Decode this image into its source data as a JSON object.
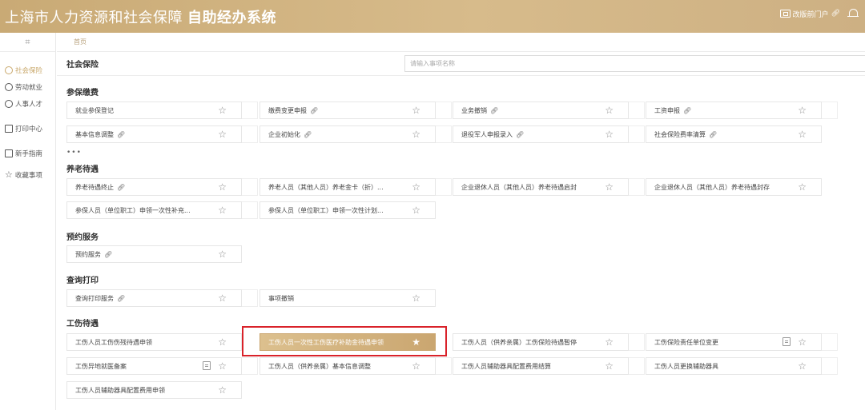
{
  "header": {
    "title_prefix": "上海市人力资源和社会保障",
    "title_bold": "自助经办系统",
    "portal_label": "改版前门户"
  },
  "sidebar": {
    "top_icon": "grid-icon",
    "items": [
      {
        "label": "社会保险",
        "icon": "social-insurance-icon",
        "active": true
      },
      {
        "label": "劳动就业",
        "icon": "employment-icon"
      },
      {
        "label": "人事人才",
        "icon": "personnel-icon"
      },
      {
        "label": "打印中心",
        "icon": "printer-icon"
      },
      {
        "label": "新手指南",
        "icon": "guide-icon"
      },
      {
        "label": "收藏事项",
        "icon": "star-icon"
      }
    ]
  },
  "breadcrumb": "首页",
  "page": {
    "title": "社会保险",
    "search_placeholder": "请输入事项名称"
  },
  "sections": {
    "s1": {
      "title": "参保缴费"
    },
    "s2": {
      "title": "养老待遇"
    },
    "s3": {
      "title": "预约服务"
    },
    "s4": {
      "title": "查询打印"
    },
    "s5": {
      "title": "工伤待遇"
    }
  },
  "more": "•••",
  "cards": {
    "c11": "就业参保登记",
    "c12": "缴费变更申报",
    "c13": "业务撤销",
    "c14": "工资申报",
    "c15": "基本信息调整",
    "c16": "企业初始化",
    "c17": "退役军人申报录入",
    "c18": "社会保险费率清算",
    "c21": "养老待遇终止",
    "c22": "养老人员（其他人员）养老金卡（折）...",
    "c23": "企业退休人员（其他人员）养老待遇启封",
    "c24": "企业退休人员（其他人员）养老待遇封存",
    "c25": "参保人员（单位职工）申领一次性补充...",
    "c26": "参保人员（单位职工）申领一次性计划...",
    "c31": "预约服务",
    "c41": "查询打印服务",
    "c42": "事项撤销",
    "c51": "工伤人员工伤伤残待遇申领",
    "c52": "工伤人员一次性工伤医疗补助金待遇申领",
    "c53": "工伤人员（供养亲属）工伤保险待遇暂停",
    "c54": "工伤保险责任单位变更",
    "c55": "工伤异地就医备案",
    "c56": "工伤人员（供养亲属）基本信息调整",
    "c57": "工伤人员辅助器具配置费用结算",
    "c58": "工伤人员更换辅助器具",
    "c59": "工伤人员辅助器具配置费用申领"
  },
  "highlight_color": "#d9222a",
  "accent_color": "#c9aa75"
}
